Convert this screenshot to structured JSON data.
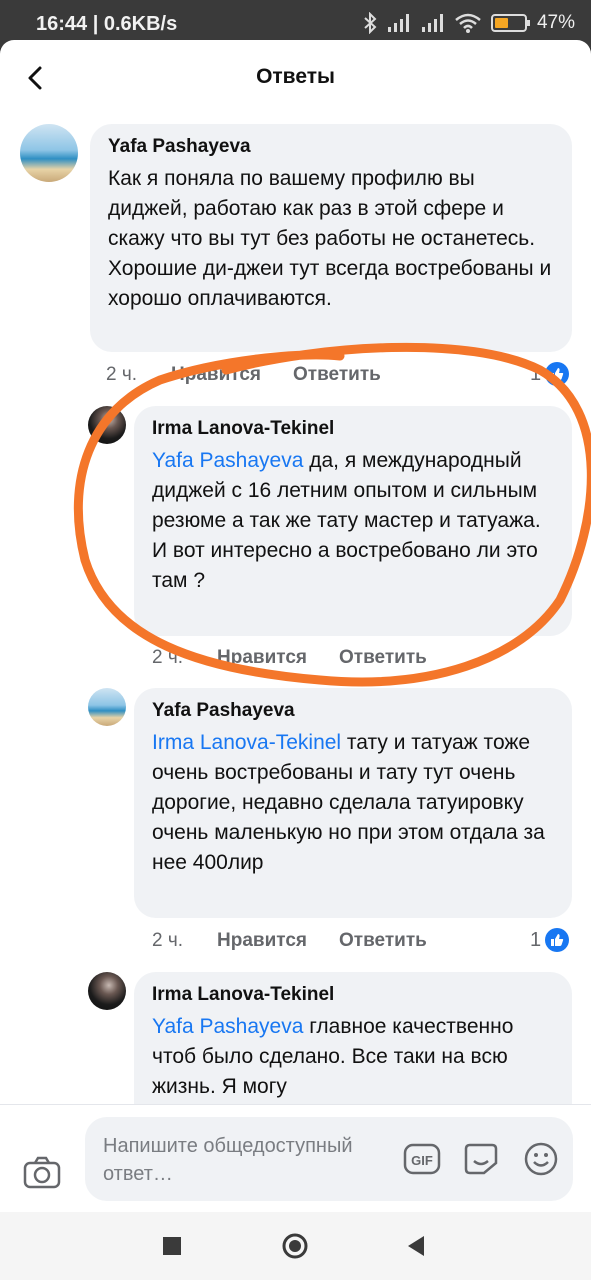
{
  "status": {
    "time_speed": "16:44 | 0.6KB/s",
    "battery": "47",
    "battery_level": 0.47,
    "icons": [
      "bluetooth-icon",
      "signal-icon",
      "signal-icon",
      "wifi-icon",
      "battery-icon"
    ]
  },
  "header": {
    "title": "Ответы"
  },
  "comments": [
    {
      "author": "Yafa Pashayeva",
      "mention": "",
      "text": "Как я поняла по вашему профилю вы диджей, работаю как раз в этой сфере и скажу что вы тут без работы не останетесь. Хорошие ди-джеи тут всегда востребованы и хорошо оплачиваются.",
      "time": "2 ч.",
      "like_label": "Нравится",
      "reply_label": "Ответить",
      "reactions": "1"
    },
    {
      "author": "Irma Lanova-Tekinel",
      "mention": "Yafa Pashayeva",
      "text": " да, я международный диджей с 16 летним опытом и сильным резюме а так же тату мастер и татуажа. И вот интересно а востребовано ли это там ?",
      "time": "2 ч.",
      "like_label": "Нравится",
      "reply_label": "Ответить",
      "reactions": ""
    },
    {
      "author": "Yafa Pashayeva",
      "mention": "Irma Lanova-Tekinel",
      "text": " тату и татуаж тоже очень востребованы и тату тут очень дорогие, недавно сделала татуировку очень маленькую но при этом отдала за нее 400лир",
      "time": "2 ч.",
      "like_label": "Нравится",
      "reply_label": "Ответить",
      "reactions": "1"
    },
    {
      "author": "Irma Lanova-Tekinel",
      "mention": "Yafa Pashayeva",
      "text": " главное качественно чтоб было сделано. Все таки на всю жизнь. Я могу",
      "time": "",
      "like_label": "",
      "reply_label": "",
      "reactions": ""
    }
  ],
  "composer": {
    "placeholder": "Напишите общедоступный ответ…",
    "icons": [
      "camera-icon",
      "gif-icon",
      "sticker-icon",
      "emoji-icon"
    ]
  },
  "navbar": {
    "icons": [
      "recents-icon",
      "home-icon",
      "back-icon"
    ]
  },
  "colors": {
    "accent": "#1877f2",
    "annotation": "#f4762a",
    "bubble": "#f0f2f5"
  }
}
